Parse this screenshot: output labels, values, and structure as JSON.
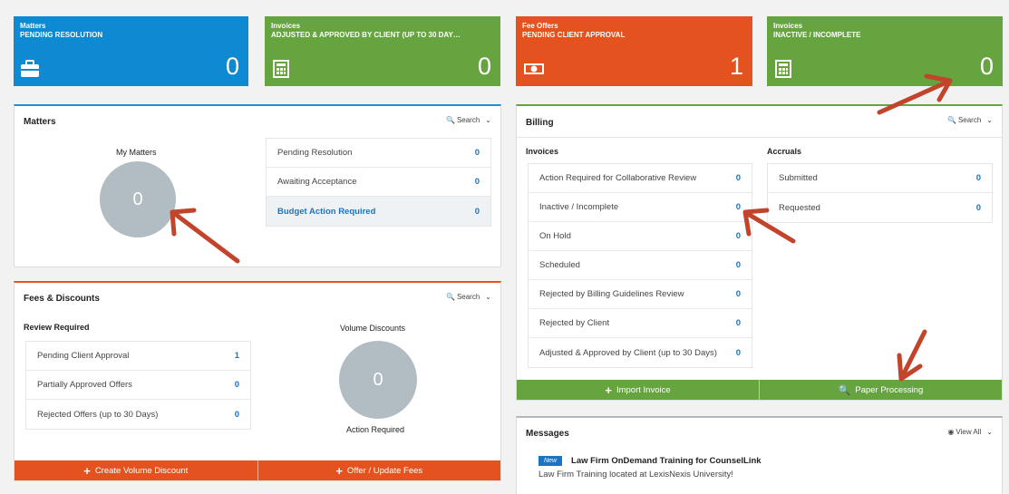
{
  "tiles": [
    {
      "title": "Matters",
      "subtitle": "PENDING RESOLUTION",
      "value": "0",
      "icon": "briefcase-icon",
      "color": "#0e8ad2"
    },
    {
      "title": "Invoices",
      "subtitle": "ADJUSTED & APPROVED BY CLIENT (UP TO 30 DAY…",
      "value": "0",
      "icon": "calculator-icon",
      "color": "#66a43f"
    },
    {
      "title": "Fee Offers",
      "subtitle": "PENDING CLIENT APPROVAL",
      "value": "1",
      "icon": "money-icon",
      "color": "#e4531f"
    },
    {
      "title": "Invoices",
      "subtitle": "INACTIVE / INCOMPLETE",
      "value": "0",
      "icon": "calculator-icon",
      "color": "#66a43f"
    }
  ],
  "matters": {
    "title": "Matters",
    "search_label": "Search",
    "my_matters_label": "My Matters",
    "my_matters_value": "0",
    "rows": [
      {
        "label": "Pending Resolution",
        "value": "0"
      },
      {
        "label": "Awaiting Acceptance",
        "value": "0"
      },
      {
        "label": "Budget Action Required",
        "value": "0"
      }
    ]
  },
  "fees": {
    "title": "Fees & Discounts",
    "search_label": "Search",
    "review_label": "Review Required",
    "rows": [
      {
        "label": "Pending Client Approval",
        "value": "1"
      },
      {
        "label": "Partially Approved Offers",
        "value": "0"
      },
      {
        "label": "Rejected Offers (up to 30 Days)",
        "value": "0"
      }
    ],
    "volume_label": "Volume Discounts",
    "volume_value": "0",
    "volume_caption": "Action Required",
    "create_button": "Create Volume Discount",
    "offer_button": "Offer / Update Fees",
    "accent": "#e4531f"
  },
  "billing": {
    "title": "Billing",
    "search_label": "Search",
    "invoices_label": "Invoices",
    "accruals_label": "Accruals",
    "invoice_rows": [
      {
        "label": "Action Required for Collaborative Review",
        "value": "0"
      },
      {
        "label": "Inactive / Incomplete",
        "value": "0"
      },
      {
        "label": "On Hold",
        "value": "0"
      },
      {
        "label": "Scheduled",
        "value": "0"
      },
      {
        "label": "Rejected by Billing Guidelines Review",
        "value": "0"
      },
      {
        "label": "Rejected by Client",
        "value": "0"
      },
      {
        "label": "Adjusted & Approved by Client (up to 30 Days)",
        "value": "0"
      }
    ],
    "accrual_rows": [
      {
        "label": "Submitted",
        "value": "0"
      },
      {
        "label": "Requested",
        "value": "0"
      }
    ],
    "import_button": "Import Invoice",
    "paper_button": "Paper Processing",
    "accent": "#66a43f"
  },
  "messages": {
    "title": "Messages",
    "view_all_label": "View All",
    "badge": "New",
    "headline": "Law Firm OnDemand Training for CounselLink",
    "body": "Law Firm Training located at LexisNexis University!"
  },
  "annotation_color": "#c2452b"
}
